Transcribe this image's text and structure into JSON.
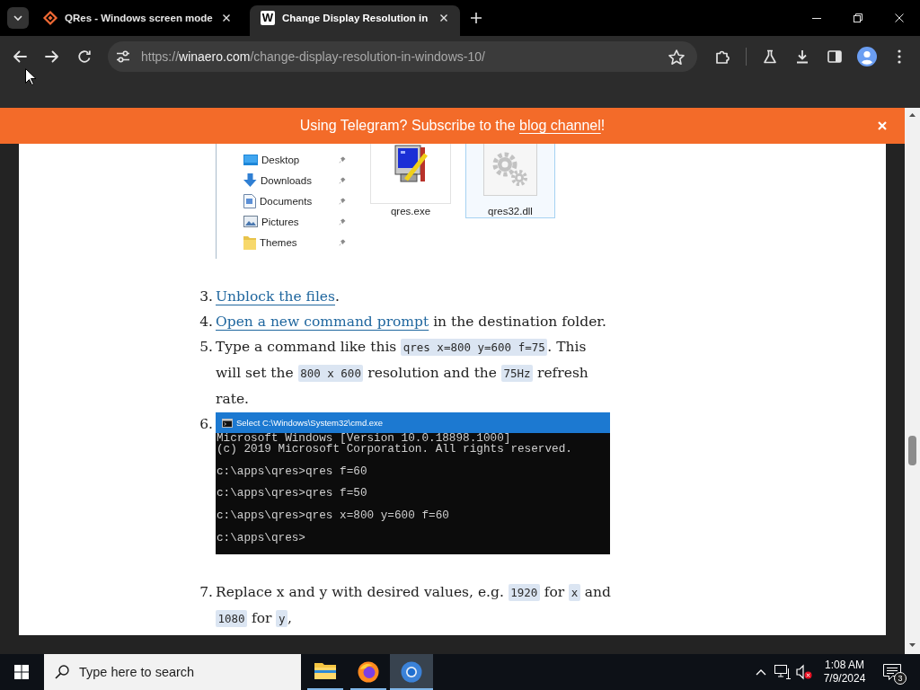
{
  "browser": {
    "tabs": [
      {
        "title": "QRes - Windows screen mode",
        "selected": false
      },
      {
        "title": "Change Display Resolution in",
        "favicon_text": "W",
        "selected": true
      }
    ],
    "url": {
      "scheme": "https://",
      "host": "winaero.com",
      "path": "/change-display-resolution-in-windows-10/"
    }
  },
  "banner": {
    "text": "Using Telegram? Subscribe to the ",
    "link": "blog channel",
    "after": "!"
  },
  "article": {
    "explorer_screenshot": {
      "nav_items": [
        {
          "label": "Desktop",
          "kind": "desktop",
          "pinned": true
        },
        {
          "label": "Downloads",
          "kind": "downloads",
          "pinned": true
        },
        {
          "label": "Documents",
          "kind": "documents",
          "pinned": true
        },
        {
          "label": "Pictures",
          "kind": "pictures",
          "pinned": true
        },
        {
          "label": "Themes",
          "kind": "folder",
          "pinned": true
        }
      ],
      "files": [
        {
          "name": "qres.exe",
          "kind": "exe",
          "selected": false
        },
        {
          "name": "qres32.dll",
          "kind": "dll",
          "selected": true
        }
      ]
    },
    "steps": [
      {
        "number": "3.",
        "kind": "text",
        "parts": [
          {
            "kind": "link",
            "text": "Unblock the files"
          },
          {
            "kind": "text",
            "text": "."
          }
        ]
      },
      {
        "number": "4.",
        "kind": "text",
        "parts": [
          {
            "kind": "link",
            "text": "Open a new command prompt"
          },
          {
            "kind": "text",
            "text": " in the destination folder."
          }
        ]
      },
      {
        "number": "5.",
        "kind": "text",
        "parts": [
          {
            "kind": "text",
            "text": "Type a command like this "
          },
          {
            "kind": "code",
            "text": "qres x=800 y=600 f=75"
          },
          {
            "kind": "text",
            "text": ". This will set the "
          },
          {
            "kind": "code",
            "text": "800 x 600"
          },
          {
            "kind": "text",
            "text": " resolution and the "
          },
          {
            "kind": "code",
            "text": "75Hz"
          },
          {
            "kind": "text",
            "text": " refresh rate."
          }
        ]
      },
      {
        "number": "6.",
        "kind": "console",
        "console": {
          "title": "Select C:\\Windows\\System32\\cmd.exe",
          "blocks": [
            [
              "Microsoft Windows [Version 10.0.18898.1000]",
              "(c) 2019 Microsoft Corporation. All rights reserved."
            ],
            [
              "c:\\apps\\qres>qres f=60"
            ],
            [
              "c:\\apps\\qres>qres f=50"
            ],
            [
              "c:\\apps\\qres>qres x=800 y=600 f=60"
            ],
            [
              "c:\\apps\\qres>"
            ]
          ]
        }
      },
      {
        "number": "7.",
        "kind": "text",
        "parts": [
          {
            "kind": "text",
            "text": "Replace x and y with desired values, e.g. "
          },
          {
            "kind": "code",
            "text": "1920"
          },
          {
            "kind": "text",
            "text": " for "
          },
          {
            "kind": "code",
            "text": "x"
          },
          {
            "kind": "text",
            "text": " and "
          },
          {
            "kind": "code",
            "text": "1080"
          },
          {
            "kind": "text",
            "text": " for "
          },
          {
            "kind": "code",
            "text": "y"
          },
          {
            "kind": "text",
            "text": ","
          }
        ]
      }
    ]
  },
  "taskbar": {
    "search": {
      "placeholder": "Type here to search"
    },
    "apps": [
      {
        "kind": "explorer",
        "running": true,
        "selected": false
      },
      {
        "kind": "firefox",
        "running": true,
        "selected": false
      },
      {
        "kind": "chrome",
        "running": true,
        "selected": true
      }
    ],
    "volume_muted": true,
    "clock": {
      "time": "1:08 AM",
      "date": "7/9/2024"
    },
    "notification_count": "3"
  }
}
